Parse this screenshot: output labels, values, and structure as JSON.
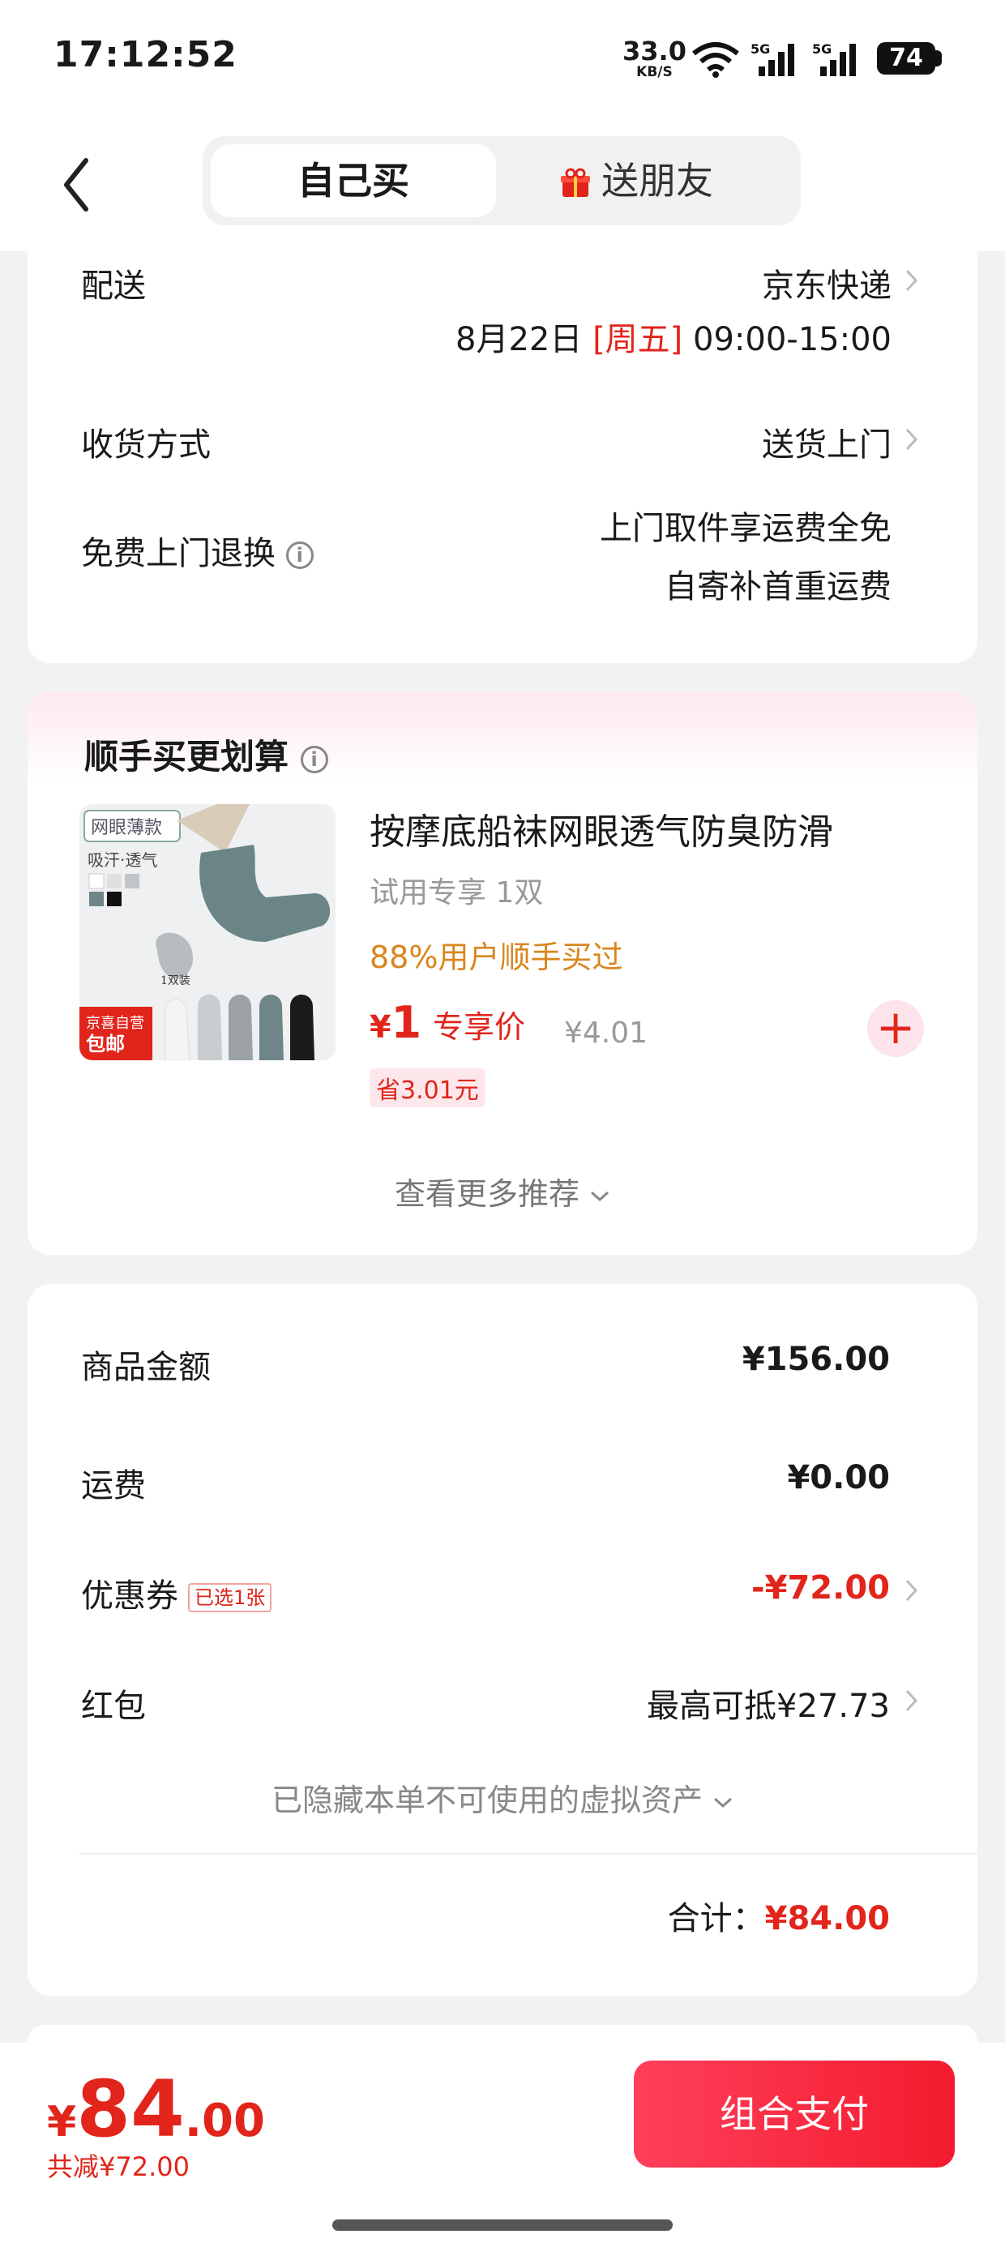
{
  "status_bar": {
    "time": "17:12:52",
    "net_speed": "33.0",
    "net_unit": "KB/S",
    "signal1": "5G",
    "signal2": "5G",
    "battery": "74"
  },
  "header": {
    "tab_self": "自己买",
    "tab_gift": "送朋友"
  },
  "delivery": {
    "label": "配送",
    "carrier": "京东快递",
    "date": "8月22日",
    "weekday": "[周五]",
    "time_range": "09:00-15:00",
    "receive_label": "收货方式",
    "receive_value": "送货上门",
    "return_label": "免费上门退换",
    "return_line1": "上门取件享运费全免",
    "return_line2": "自寄补首重运费"
  },
  "addon": {
    "title": "顺手买更划算",
    "thumb_tag": "网眼薄款",
    "thumb_sub": "吸汗·透气",
    "thumb_badge_1": "京喜自营",
    "thumb_badge_2": "包邮",
    "thumb_pack": "1双装",
    "product_title": "按摩底船袜网眼透气防臭防滑",
    "product_sub": "试用专享 1双",
    "hot_text": "88%用户顺手买过",
    "price_symbol": "¥",
    "price": "1",
    "price_tag": "专享价",
    "orig_price": "¥4.01",
    "save_text": "省3.01元",
    "more_text": "查看更多推荐"
  },
  "summary": {
    "goods_label": "商品金额",
    "goods_value": "¥156.00",
    "freight_label": "运费",
    "freight_value": "¥0.00",
    "coupon_label": "优惠券",
    "coupon_badge": "已选1张",
    "coupon_value": "-¥72.00",
    "hongbao_label": "红包",
    "hongbao_value": "最高可抵¥27.73",
    "hidden_text": "已隐藏本单不可使用的虚拟资产",
    "total_label": "合计：",
    "total_value": "¥84.00"
  },
  "footer": {
    "price_symbol": "¥",
    "price_int": "84",
    "price_dec": ".00",
    "saved": "共减¥72.00",
    "pay_button": "组合支付"
  },
  "colors": {
    "accent": "#e1251b",
    "hot": "#d8861e",
    "pay_gradient_start": "#ff3f5b",
    "pay_gradient_end": "#f31b2d"
  }
}
